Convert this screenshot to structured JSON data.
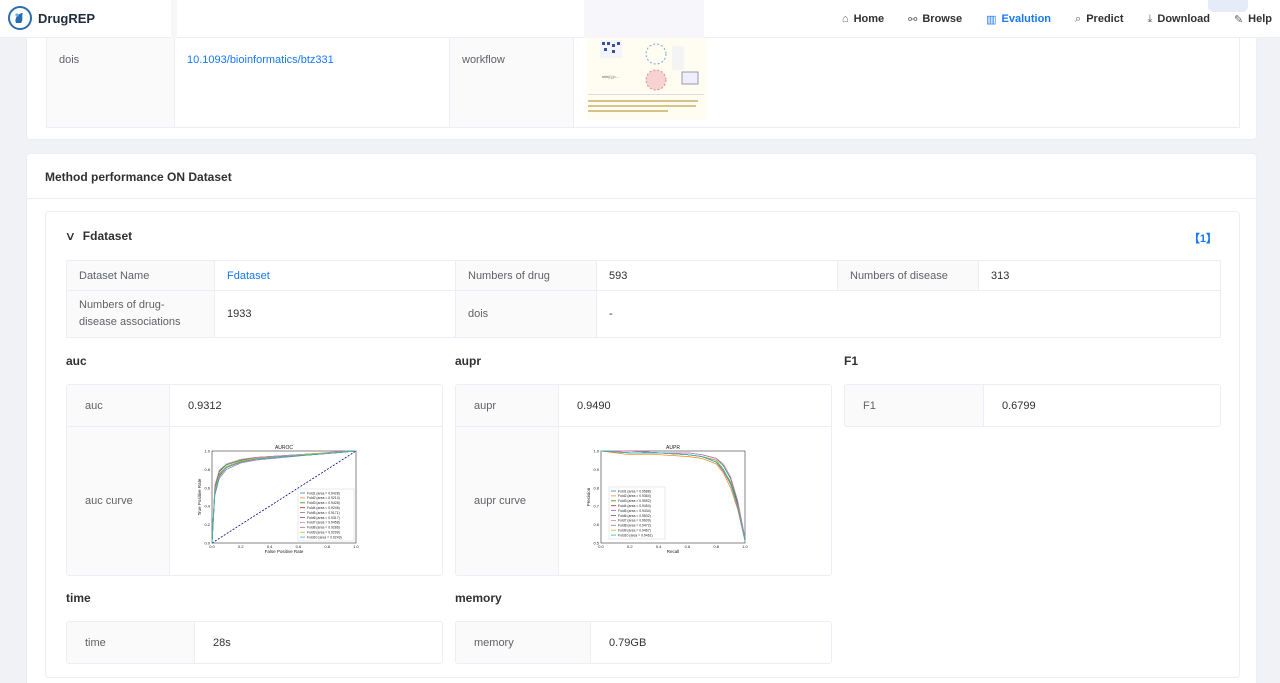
{
  "app": {
    "title": "DrugREP"
  },
  "nav": [
    {
      "label": "Home",
      "icon": "home-icon",
      "glyph": "⌂"
    },
    {
      "label": "Browse",
      "icon": "sitemap-icon",
      "glyph": "⚯"
    },
    {
      "label": "Evalution",
      "icon": "bar-chart-icon",
      "glyph": "▥",
      "active": true
    },
    {
      "label": "Predict",
      "icon": "search-icon",
      "glyph": "⌕"
    },
    {
      "label": "Download",
      "icon": "download-icon",
      "glyph": "⤓"
    },
    {
      "label": "Help",
      "icon": "wrench-icon",
      "glyph": "✎"
    }
  ],
  "method_info": {
    "dois_label": "dois",
    "dois_value": "10.1093/bioinformatics/btz331",
    "workflow_label": "workflow"
  },
  "performance": {
    "section_title": "Method performance ON Dataset",
    "dataset_header": "Fdataset",
    "result_count": "【1】",
    "dataset": {
      "name_label": "Dataset Name",
      "name_value": "Fdataset",
      "drugs_label": "Numbers of drug",
      "drugs_value": "593",
      "diseases_label": "Numbers of disease",
      "diseases_value": "313",
      "assoc_label": "Numbers of drug-disease associations",
      "assoc_value": "1933",
      "dois_label": "dois",
      "dois_value": "-"
    },
    "auc": {
      "title": "auc",
      "label": "auc",
      "value": "0.9312",
      "curve_label": "auc curve"
    },
    "aupr": {
      "title": "aupr",
      "label": "aupr",
      "value": "0.9490",
      "curve_label": "aupr curve"
    },
    "f1": {
      "title": "F1",
      "label": "F1",
      "value": "0.6799"
    },
    "time": {
      "title": "time",
      "label": "time",
      "value": "28s"
    },
    "memory": {
      "title": "memory",
      "label": "memory",
      "value": "0.79GB"
    }
  },
  "chart_data": [
    {
      "type": "line",
      "title": "AUROC",
      "xlabel": "False Positive Rate",
      "ylabel": "True Positive Rate",
      "xlim": [
        0,
        1
      ],
      "ylim": [
        0,
        1
      ],
      "xticks": [
        "0.0",
        "0.2",
        "0.4",
        "0.6",
        "0.8",
        "1.0"
      ],
      "yticks": [
        "0.0",
        "0.2",
        "0.4",
        "0.6",
        "0.8",
        "1.0"
      ],
      "legend": "lower-right",
      "x": [
        0,
        0.02,
        0.05,
        0.1,
        0.2,
        0.3,
        0.5,
        0.7,
        0.85,
        1.0
      ],
      "series": [
        {
          "name": "Fold1 (area = 0.9428)",
          "color": "#1f77b4",
          "values": [
            0,
            0.62,
            0.78,
            0.85,
            0.9,
            0.93,
            0.95,
            0.97,
            0.98,
            1.0
          ]
        },
        {
          "name": "Fold2 (area = 0.9214)",
          "color": "#ff7f0e",
          "values": [
            0,
            0.55,
            0.72,
            0.82,
            0.88,
            0.91,
            0.94,
            0.96,
            0.98,
            1.0
          ]
        },
        {
          "name": "Fold3 (area = 0.9428)",
          "color": "#2ca02c",
          "values": [
            0,
            0.6,
            0.77,
            0.85,
            0.9,
            0.93,
            0.95,
            0.97,
            0.98,
            1.0
          ]
        },
        {
          "name": "Fold4 (area = 0.9246)",
          "color": "#d62728",
          "values": [
            0,
            0.56,
            0.73,
            0.82,
            0.88,
            0.91,
            0.94,
            0.96,
            0.98,
            1.0
          ]
        },
        {
          "name": "Fold5 (area = 0.9171)",
          "color": "#9467bd",
          "values": [
            0,
            0.52,
            0.7,
            0.8,
            0.87,
            0.9,
            0.93,
            0.96,
            0.98,
            1.0
          ]
        },
        {
          "name": "Fold6 (area = 0.9317)",
          "color": "#8c564b",
          "values": [
            0,
            0.58,
            0.75,
            0.83,
            0.89,
            0.92,
            0.94,
            0.96,
            0.98,
            1.0
          ]
        },
        {
          "name": "Fold7 (area = 0.9458)",
          "color": "#e377c2",
          "values": [
            0,
            0.63,
            0.79,
            0.86,
            0.91,
            0.93,
            0.95,
            0.97,
            0.99,
            1.0
          ]
        },
        {
          "name": "Fold8 (area = 0.9286)",
          "color": "#7f7f7f",
          "values": [
            0,
            0.57,
            0.74,
            0.83,
            0.89,
            0.92,
            0.94,
            0.96,
            0.98,
            1.0
          ]
        },
        {
          "name": "Fold9 (area = 0.9299)",
          "color": "#bcbd22",
          "values": [
            0,
            0.57,
            0.74,
            0.83,
            0.89,
            0.92,
            0.94,
            0.97,
            0.98,
            1.0
          ]
        },
        {
          "name": "Fold10 (area = 0.9243)",
          "color": "#17becf",
          "values": [
            0,
            0.54,
            0.72,
            0.82,
            0.88,
            0.91,
            0.94,
            0.96,
            0.98,
            1.0
          ]
        }
      ]
    },
    {
      "type": "line",
      "title": "AUPR",
      "xlabel": "Recall",
      "ylabel": "Precision",
      "xlim": [
        0,
        1
      ],
      "ylim": [
        0.5,
        1
      ],
      "xticks": [
        "0.0",
        "0.2",
        "0.4",
        "0.6",
        "0.8",
        "1.0"
      ],
      "yticks": [
        "0.5",
        "0.6",
        "0.7",
        "0.8",
        "0.9",
        "1.0"
      ],
      "legend": "lower-left",
      "x": [
        0,
        0.2,
        0.4,
        0.6,
        0.7,
        0.8,
        0.85,
        0.9,
        0.95,
        1.0
      ],
      "series": [
        {
          "name": "Fold1 (area = 0.9588)",
          "color": "#1f77b4",
          "values": [
            1.0,
            1.0,
            0.99,
            0.99,
            0.98,
            0.96,
            0.92,
            0.85,
            0.72,
            0.52
          ]
        },
        {
          "name": "Fold2 (area = 0.9364)",
          "color": "#ff7f0e",
          "values": [
            1.0,
            0.98,
            0.98,
            0.97,
            0.96,
            0.93,
            0.88,
            0.8,
            0.68,
            0.51
          ]
        },
        {
          "name": "Fold3 (area = 0.9592)",
          "color": "#2ca02c",
          "values": [
            1.0,
            1.0,
            0.99,
            0.99,
            0.98,
            0.96,
            0.92,
            0.85,
            0.72,
            0.52
          ]
        },
        {
          "name": "Fold4 (area = 0.9454)",
          "color": "#d62728",
          "values": [
            1.0,
            0.99,
            0.99,
            0.98,
            0.97,
            0.94,
            0.89,
            0.82,
            0.7,
            0.52
          ]
        },
        {
          "name": "Fold5 (area = 0.9434)",
          "color": "#9467bd",
          "values": [
            1.0,
            0.99,
            0.99,
            0.98,
            0.97,
            0.94,
            0.89,
            0.82,
            0.69,
            0.51
          ]
        },
        {
          "name": "Fold6 (area = 0.9502)",
          "color": "#8c564b",
          "values": [
            1.0,
            1.0,
            0.99,
            0.98,
            0.97,
            0.95,
            0.9,
            0.83,
            0.71,
            0.52
          ]
        },
        {
          "name": "Fold7 (area = 0.9609)",
          "color": "#e377c2",
          "values": [
            1.0,
            1.0,
            0.99,
            0.99,
            0.98,
            0.96,
            0.93,
            0.86,
            0.73,
            0.53
          ]
        },
        {
          "name": "Fold8 (area = 0.9472)",
          "color": "#7f7f7f",
          "values": [
            1.0,
            0.99,
            0.99,
            0.98,
            0.97,
            0.95,
            0.9,
            0.82,
            0.7,
            0.52
          ]
        },
        {
          "name": "Fold9 (area = 0.9467)",
          "color": "#bcbd22",
          "values": [
            1.0,
            0.99,
            0.99,
            0.98,
            0.97,
            0.95,
            0.9,
            0.82,
            0.7,
            0.51
          ]
        },
        {
          "name": "Fold10 (area = 0.9461)",
          "color": "#17becf",
          "values": [
            1.0,
            0.99,
            0.99,
            0.98,
            0.97,
            0.94,
            0.9,
            0.82,
            0.7,
            0.51
          ]
        }
      ]
    }
  ]
}
